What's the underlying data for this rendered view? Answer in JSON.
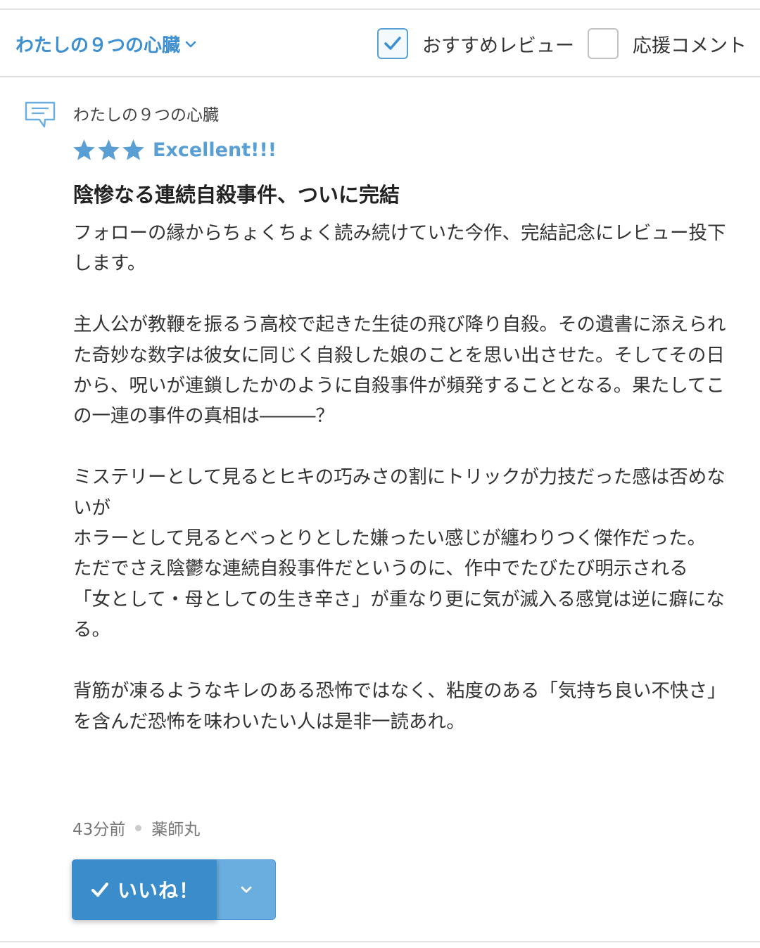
{
  "header": {
    "work_title": "わたしの９つの心臓",
    "filters": [
      {
        "label": "おすすめレビュー",
        "checked": true
      },
      {
        "label": "応援コメント",
        "checked": false
      }
    ]
  },
  "review": {
    "work_title": "わたしの９つの心臓",
    "rating_stars": 3,
    "rating_label": "Excellent!!!",
    "title": "陰惨なる連続自殺事件、ついに完結",
    "paragraphs": [
      "フォローの縁からちょくちょく読み続けていた今作、完結記念にレビュー投下します。",
      "",
      "主人公が教鞭を振るう高校で起きた生徒の飛び降り自殺。その遺書に添えられた奇妙な数字は彼女に同じく自殺した娘のことを思い出させた。そしてその日から、呪いが連鎖したかのように自殺事件が頻発することとなる。果たしてこの一連の事件の真相は―――？",
      "",
      "ミステリーとして見るとヒキの巧みさの割にトリックが力技だった感は否めないが",
      "ホラーとして見るとべっとりとした嫌ったい感じが纏わりつく傑作だった。",
      "ただでさえ陰鬱な連続自殺事件だというのに、作中でたびたび明示される",
      "「女として・母としての生き辛さ」が重なり更に気が滅入る感覚は逆に癖になる。",
      "",
      "背筋が凍るようなキレのある恐怖ではなく、粘度のある「気持ち良い不快さ」を含んだ恐怖を味わいたい人は是非一読あれ。"
    ],
    "time_ago": "43分前",
    "author": "薬師丸",
    "like_label": "いいね！"
  },
  "colors": {
    "accent": "#3c8fd0",
    "star": "#5a9fd4",
    "like_button": "#3a8ccb",
    "like_more": "#6aaee0"
  },
  "icons": [
    "chevron-down-icon",
    "checkmark-icon",
    "comment-icon",
    "star-icon"
  ]
}
